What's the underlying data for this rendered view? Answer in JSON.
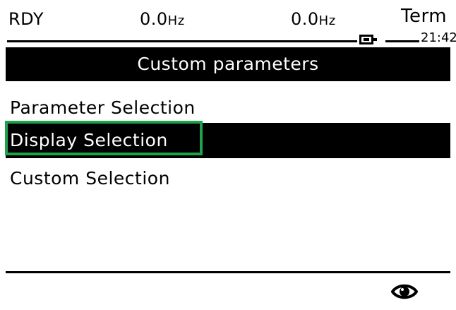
{
  "status_bar": {
    "state": "RDY",
    "freq1_value": "0.0",
    "freq1_unit": "Hz",
    "freq2_value": "0.0",
    "freq2_unit": "Hz",
    "mode": "Term",
    "time": "21:42",
    "battery_icon": "battery-icon"
  },
  "header": {
    "title": "Custom parameters"
  },
  "menu": {
    "items": [
      {
        "label": "Parameter Selection",
        "selected": false
      },
      {
        "label": "Display Selection",
        "selected": true
      },
      {
        "label": "Custom Selection",
        "selected": false
      }
    ]
  },
  "footer": {
    "icon": "eye-icon"
  },
  "colors": {
    "background": "#ffffff",
    "foreground": "#000000",
    "highlight_text": "#ffffff",
    "focus_outline": "#1ea24a"
  }
}
